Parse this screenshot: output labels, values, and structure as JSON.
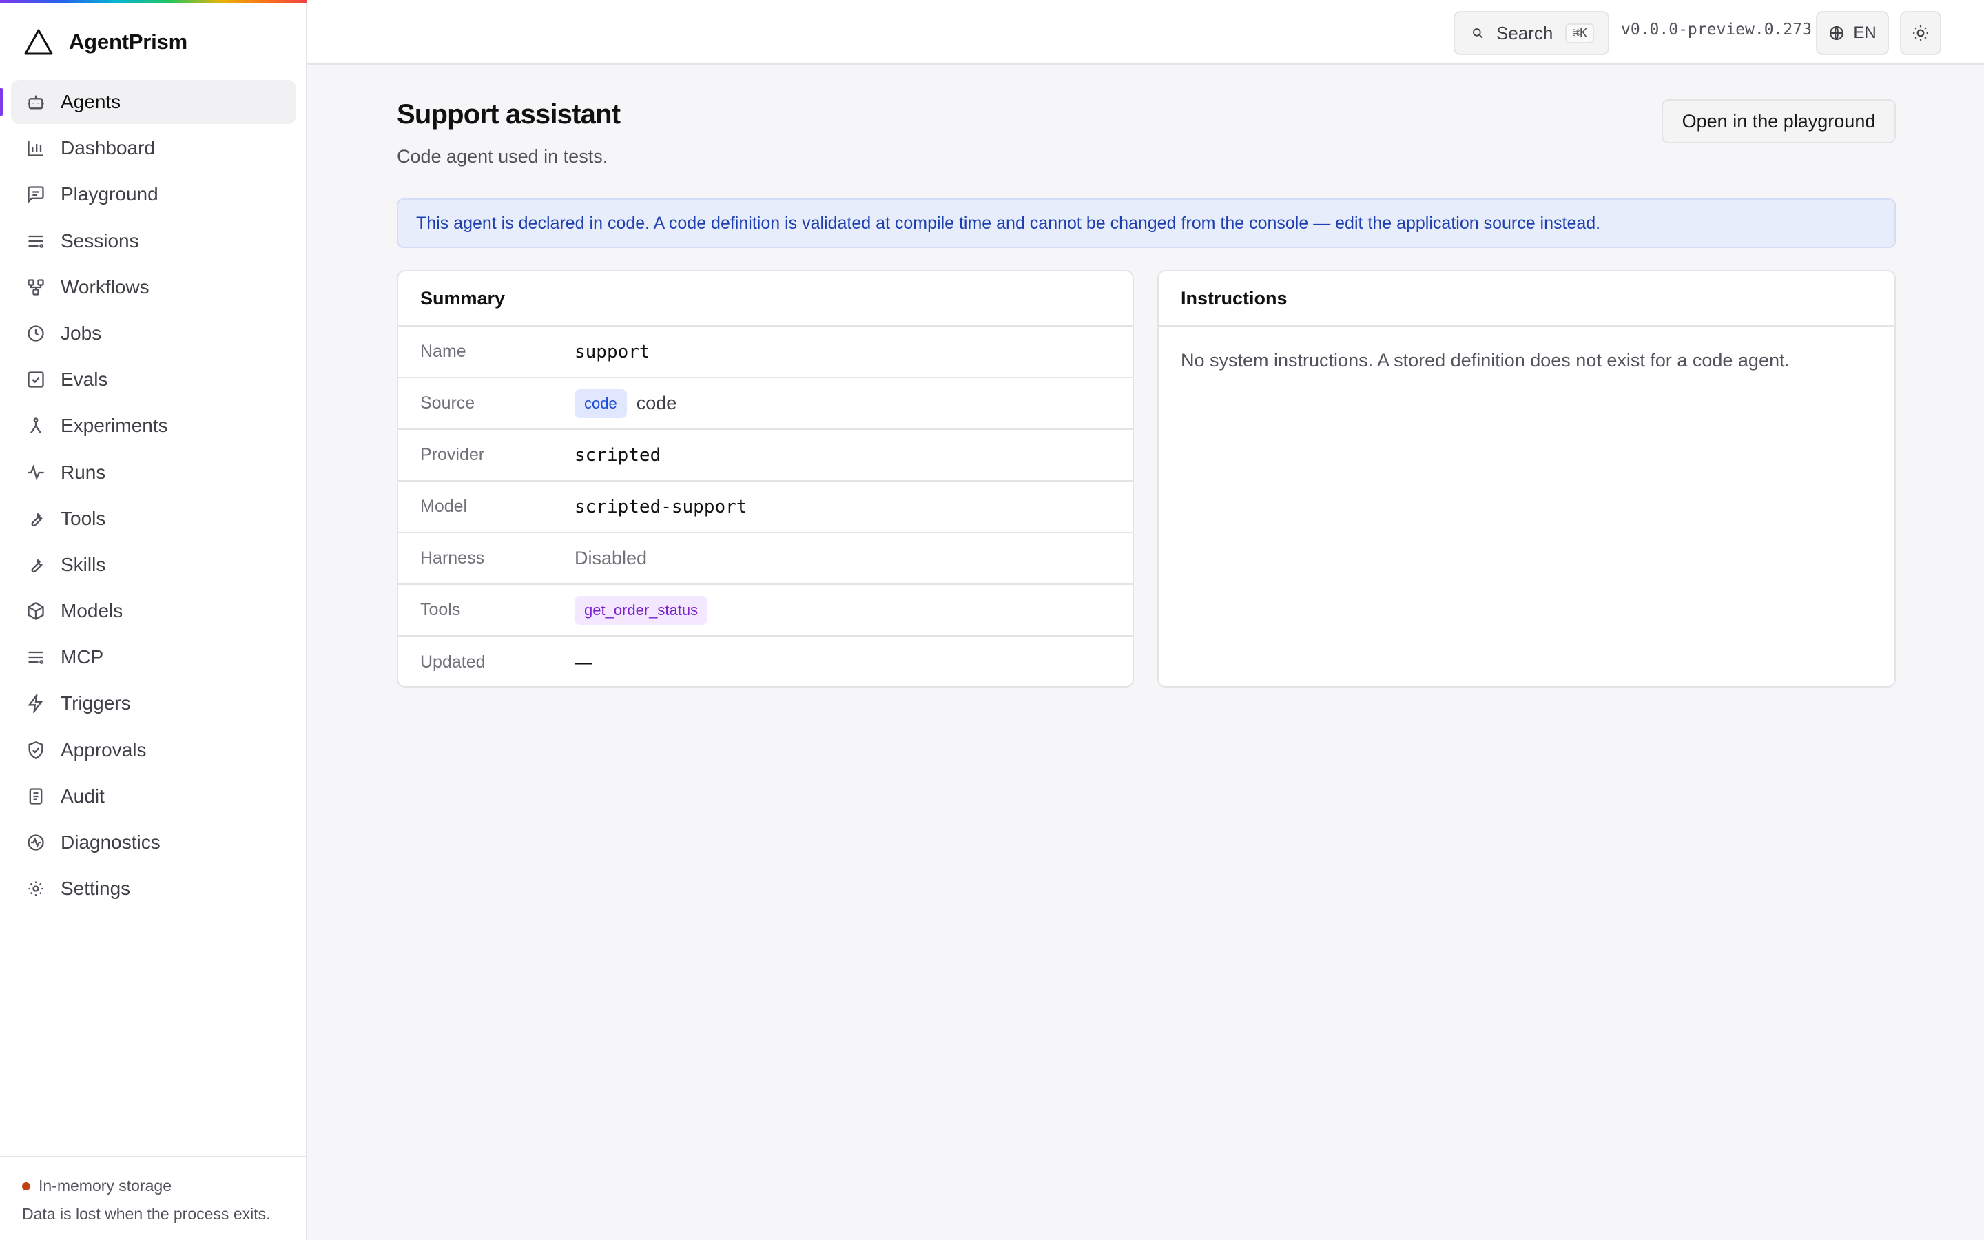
{
  "app": {
    "name": "AgentPrism"
  },
  "sidebar": {
    "items": [
      {
        "label": "Agents",
        "icon": "robot-icon",
        "active": true
      },
      {
        "label": "Dashboard",
        "icon": "bar-chart-icon"
      },
      {
        "label": "Playground",
        "icon": "message-icon"
      },
      {
        "label": "Sessions",
        "icon": "list-icon"
      },
      {
        "label": "Workflows",
        "icon": "workflow-icon"
      },
      {
        "label": "Jobs",
        "icon": "clock-icon"
      },
      {
        "label": "Evals",
        "icon": "check-square-icon"
      },
      {
        "label": "Experiments",
        "icon": "branch-icon"
      },
      {
        "label": "Runs",
        "icon": "activity-icon"
      },
      {
        "label": "Tools",
        "icon": "wrench-icon"
      },
      {
        "label": "Skills",
        "icon": "wrench-icon"
      },
      {
        "label": "Models",
        "icon": "cube-icon"
      },
      {
        "label": "MCP",
        "icon": "list-icon"
      },
      {
        "label": "Triggers",
        "icon": "lightning-icon"
      },
      {
        "label": "Approvals",
        "icon": "shield-check-icon"
      },
      {
        "label": "Audit",
        "icon": "document-icon"
      },
      {
        "label": "Diagnostics",
        "icon": "pulse-icon"
      },
      {
        "label": "Settings",
        "icon": "gear-icon"
      }
    ],
    "footer": {
      "storage_label": "In-memory storage",
      "storage_note": "Data is lost when the process exits.",
      "status_color": "#c2410c"
    }
  },
  "topbar": {
    "search_label": "Search",
    "search_shortcut": "⌘K",
    "version": "v0.0.0-preview.0.273",
    "language": "EN"
  },
  "page": {
    "title": "Support assistant",
    "subtitle": "Code agent used in tests.",
    "playground_button": "Open in the playground",
    "alert": "This agent is declared in code. A code definition is validated at compile time and cannot be changed from the console — edit the application source instead."
  },
  "summary": {
    "title": "Summary",
    "rows": [
      {
        "label": "Name",
        "value": "support"
      },
      {
        "label": "Source",
        "badge": "code",
        "value": "code"
      },
      {
        "label": "Provider",
        "value": "scripted"
      },
      {
        "label": "Model",
        "value": "scripted-support"
      },
      {
        "label": "Harness",
        "value": "Disabled"
      },
      {
        "label": "Tools",
        "badge": "get_order_status"
      },
      {
        "label": "Updated",
        "value": "—"
      }
    ]
  },
  "instructions": {
    "title": "Instructions",
    "body": "No system instructions. A stored definition does not exist for a code agent."
  },
  "colors": {
    "accent": "#7c3aed",
    "alert_bg": "#e8edfb",
    "alert_text": "#1e40af"
  }
}
